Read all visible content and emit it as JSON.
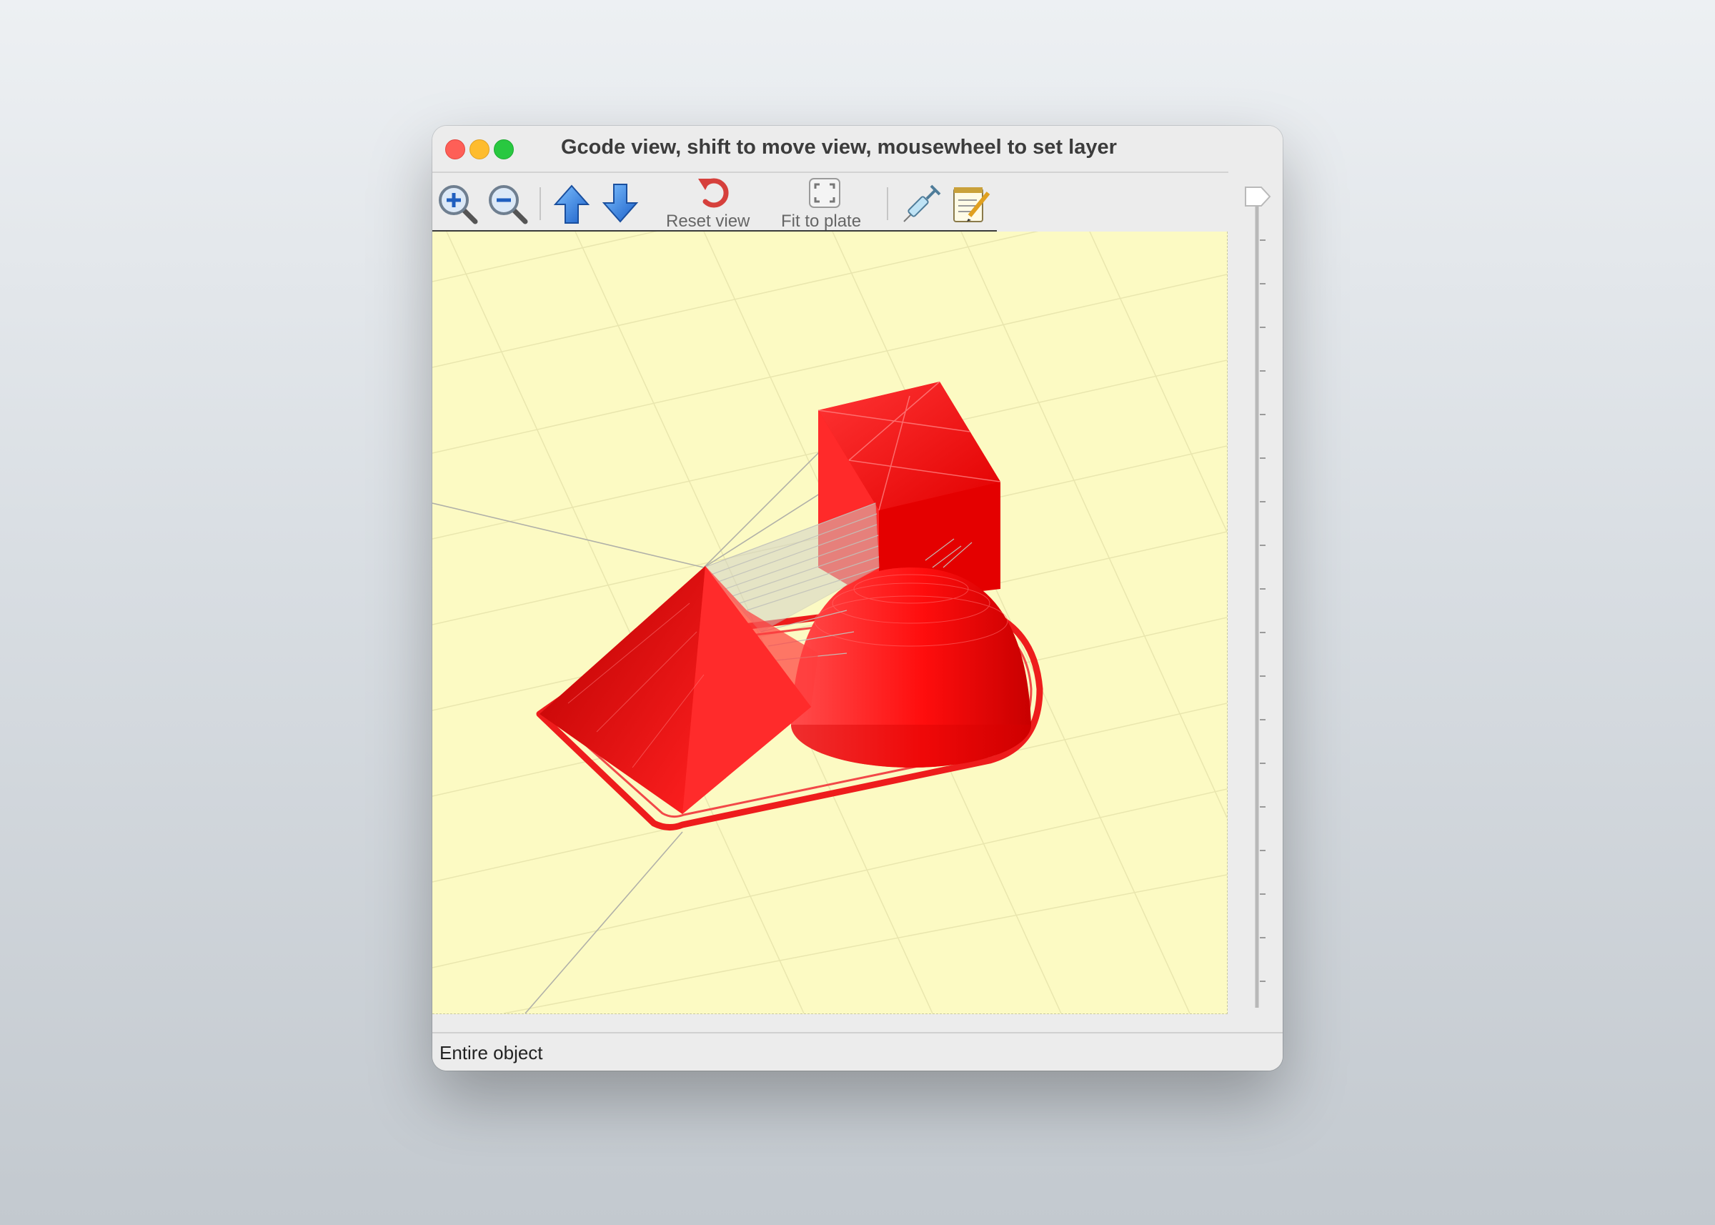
{
  "window": {
    "title": "Gcode view, shift to move view, mousewheel to set layer"
  },
  "toolbar": {
    "zoom_in_icon": "zoom-in-icon",
    "zoom_out_icon": "zoom-out-icon",
    "layer_up_icon": "arrow-up-icon",
    "layer_down_icon": "arrow-down-icon",
    "reset_view_label": "Reset view",
    "fit_to_plate_label": "Fit to plate",
    "tool_icon": "syringe-icon",
    "notes_icon": "notepad-icon"
  },
  "status": {
    "text": "Entire object"
  },
  "colors": {
    "plate": "#fcfac3",
    "model": "#ff1a1a",
    "travel": "#b8b8b8"
  }
}
